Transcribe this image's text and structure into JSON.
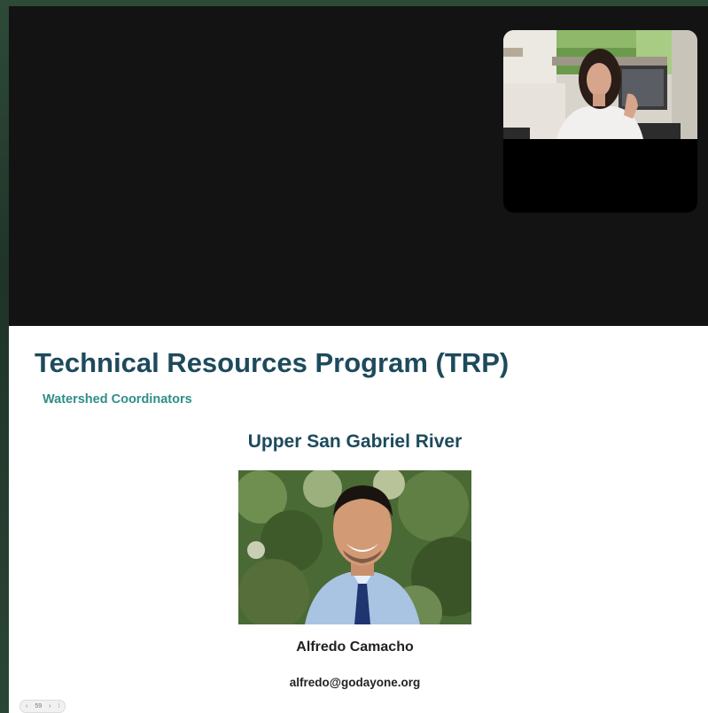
{
  "slide": {
    "title": "Technical Resources Program (TRP)",
    "subtitle": "Watershed Coordinators",
    "region": "Upper San Gabriel River",
    "coordinator_name": "Alfredo Camacho",
    "coordinator_email": "alfredo@godayone.org"
  },
  "slide_nav": {
    "prev_glyph": "‹",
    "page_number": "59",
    "next_glyph": "›",
    "fullscreen_glyph": "⁞"
  },
  "colors": {
    "title": "#1d4a5c",
    "subtitle": "#2f8f86",
    "stage_background": "#131313"
  }
}
